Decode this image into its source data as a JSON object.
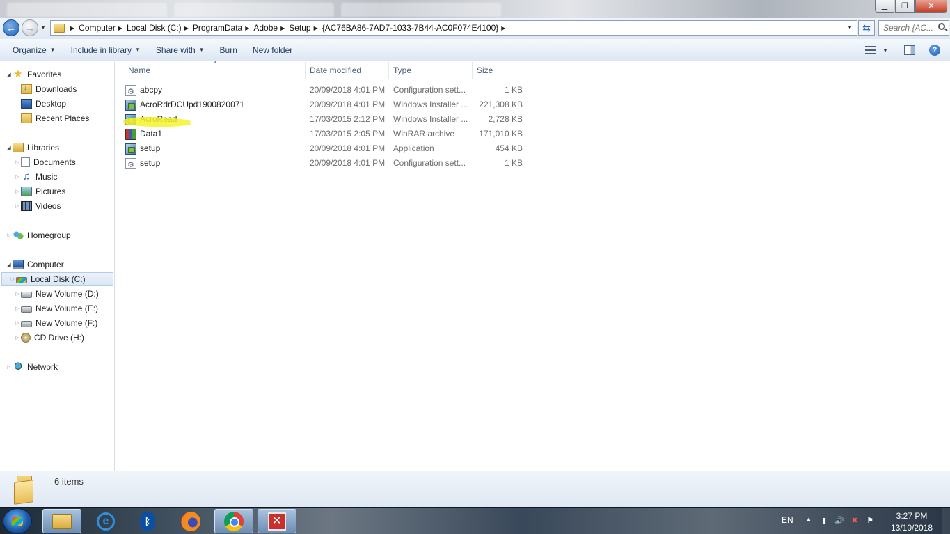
{
  "window": {
    "title_controls": {
      "minimize": "▁",
      "maximize": "❐",
      "close": "✕"
    }
  },
  "address": {
    "breadcrumbs": [
      "Computer",
      "Local Disk (C:)",
      "ProgramData",
      "Adobe",
      "Setup",
      "{AC76BA86-7AD7-1033-7B44-AC0F074E4100}"
    ],
    "search_placeholder": "Search {AC..."
  },
  "toolbar": {
    "organize": "Organize",
    "include_in_library": "Include in library",
    "share_with": "Share with",
    "burn": "Burn",
    "new_folder": "New folder"
  },
  "nav": {
    "favorites": {
      "label": "Favorites",
      "items": [
        "Downloads",
        "Desktop",
        "Recent Places"
      ]
    },
    "libraries": {
      "label": "Libraries",
      "items": [
        "Documents",
        "Music",
        "Pictures",
        "Videos"
      ]
    },
    "homegroup": "Homegroup",
    "computer": {
      "label": "Computer",
      "items": [
        "Local Disk (C:)",
        "New Volume (D:)",
        "New Volume (E:)",
        "New Volume (F:)",
        "CD Drive (H:)"
      ]
    },
    "network": "Network"
  },
  "columns": {
    "name": "Name",
    "date": "Date modified",
    "type": "Type",
    "size": "Size"
  },
  "files": [
    {
      "name": "abcpy",
      "date": "20/09/2018 4:01 PM",
      "type": "Configuration sett...",
      "size": "1 KB",
      "icon": "config-file-icon"
    },
    {
      "name": "AcroRdrDCUpd1900820071",
      "date": "20/09/2018 4:01 PM",
      "type": "Windows Installer ...",
      "size": "221,308 KB",
      "icon": "installer-icon"
    },
    {
      "name": "AcroRead",
      "date": "17/03/2015 2:12 PM",
      "type": "Windows Installer ...",
      "size": "2,728 KB",
      "icon": "installer-icon"
    },
    {
      "name": "Data1",
      "date": "17/03/2015 2:05 PM",
      "type": "WinRAR archive",
      "size": "171,010 KB",
      "icon": "winrar-icon"
    },
    {
      "name": "setup",
      "date": "20/09/2018 4:01 PM",
      "type": "Application",
      "size": "454 KB",
      "icon": "application-icon"
    },
    {
      "name": "setup",
      "date": "20/09/2018 4:01 PM",
      "type": "Configuration sett...",
      "size": "1 KB",
      "icon": "config-file-icon"
    }
  ],
  "details": {
    "item_count": "6 items"
  },
  "taskbar": {
    "language": "EN",
    "time": "3:27 PM",
    "date": "13/10/2018",
    "highlight_color": "#f5f52a"
  }
}
